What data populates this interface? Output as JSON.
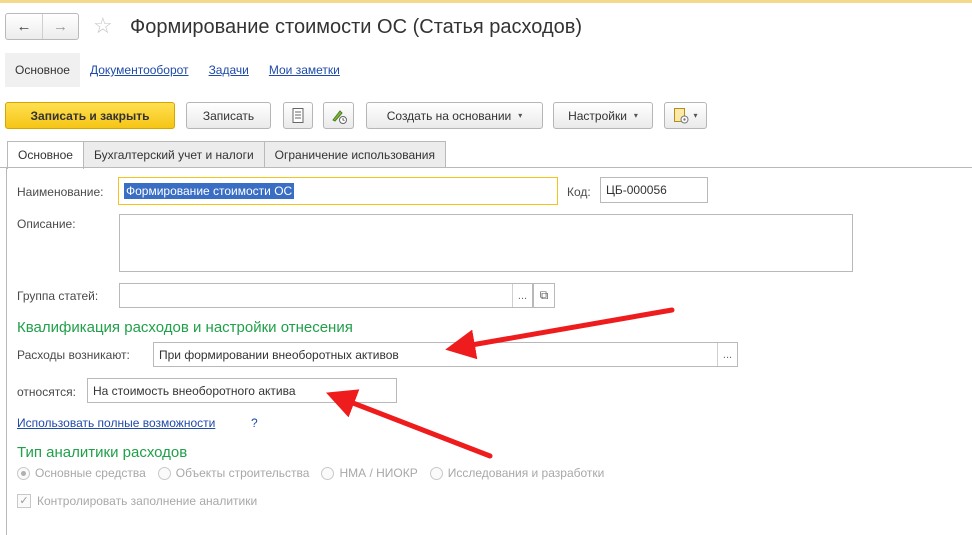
{
  "window": {
    "title": "Формирование стоимости ОС (Статья расходов)",
    "back_glyph": "←",
    "forward_glyph": "→",
    "favorite_glyph": "☆"
  },
  "section_tabs": [
    {
      "label": "Основное"
    },
    {
      "label": "Документооборот"
    },
    {
      "label": "Задачи"
    },
    {
      "label": "Мои заметки"
    }
  ],
  "toolbar": {
    "save_close": "Записать и закрыть",
    "save": "Записать",
    "create_based": "Создать на основании",
    "settings": "Настройки",
    "caret": "▾"
  },
  "form_tabs": [
    {
      "label": "Основное"
    },
    {
      "label": "Бухгалтерский учет и налоги"
    },
    {
      "label": "Ограничение использования"
    }
  ],
  "form": {
    "name_label": "Наименование:",
    "name_value": "Формирование стоимости ОС",
    "code_label": "Код:",
    "code_value": "ЦБ-000056",
    "description_label": "Описание:",
    "description_value": "",
    "group_label": "Группа статей:",
    "group_value": "",
    "select_glyph": "...",
    "open_glyph": "⧉"
  },
  "qualification": {
    "heading": "Квалификация расходов и настройки отнесения",
    "occur_label": "Расходы возникают:",
    "occur_value": "При формировании внеоборотных активов",
    "relate_label": "относятся:",
    "relate_value": "На стоимость внеоборотного актива",
    "full_link": "Использовать полные возможности",
    "help": "?"
  },
  "analytics": {
    "heading": "Тип аналитики расходов",
    "options": [
      {
        "label": "Основные средства"
      },
      {
        "label": "Объекты строительства"
      },
      {
        "label": "НМА / НИОКР"
      },
      {
        "label": "Исследования и разработки"
      }
    ],
    "control_label": "Контролировать заполнение аналитики",
    "check_glyph": "✓"
  },
  "colors": {
    "accent_yellow": "#f5c515",
    "section_green": "#20a04a",
    "link_blue": "#1f4aa8",
    "arrow_red": "#ee1c1c"
  }
}
